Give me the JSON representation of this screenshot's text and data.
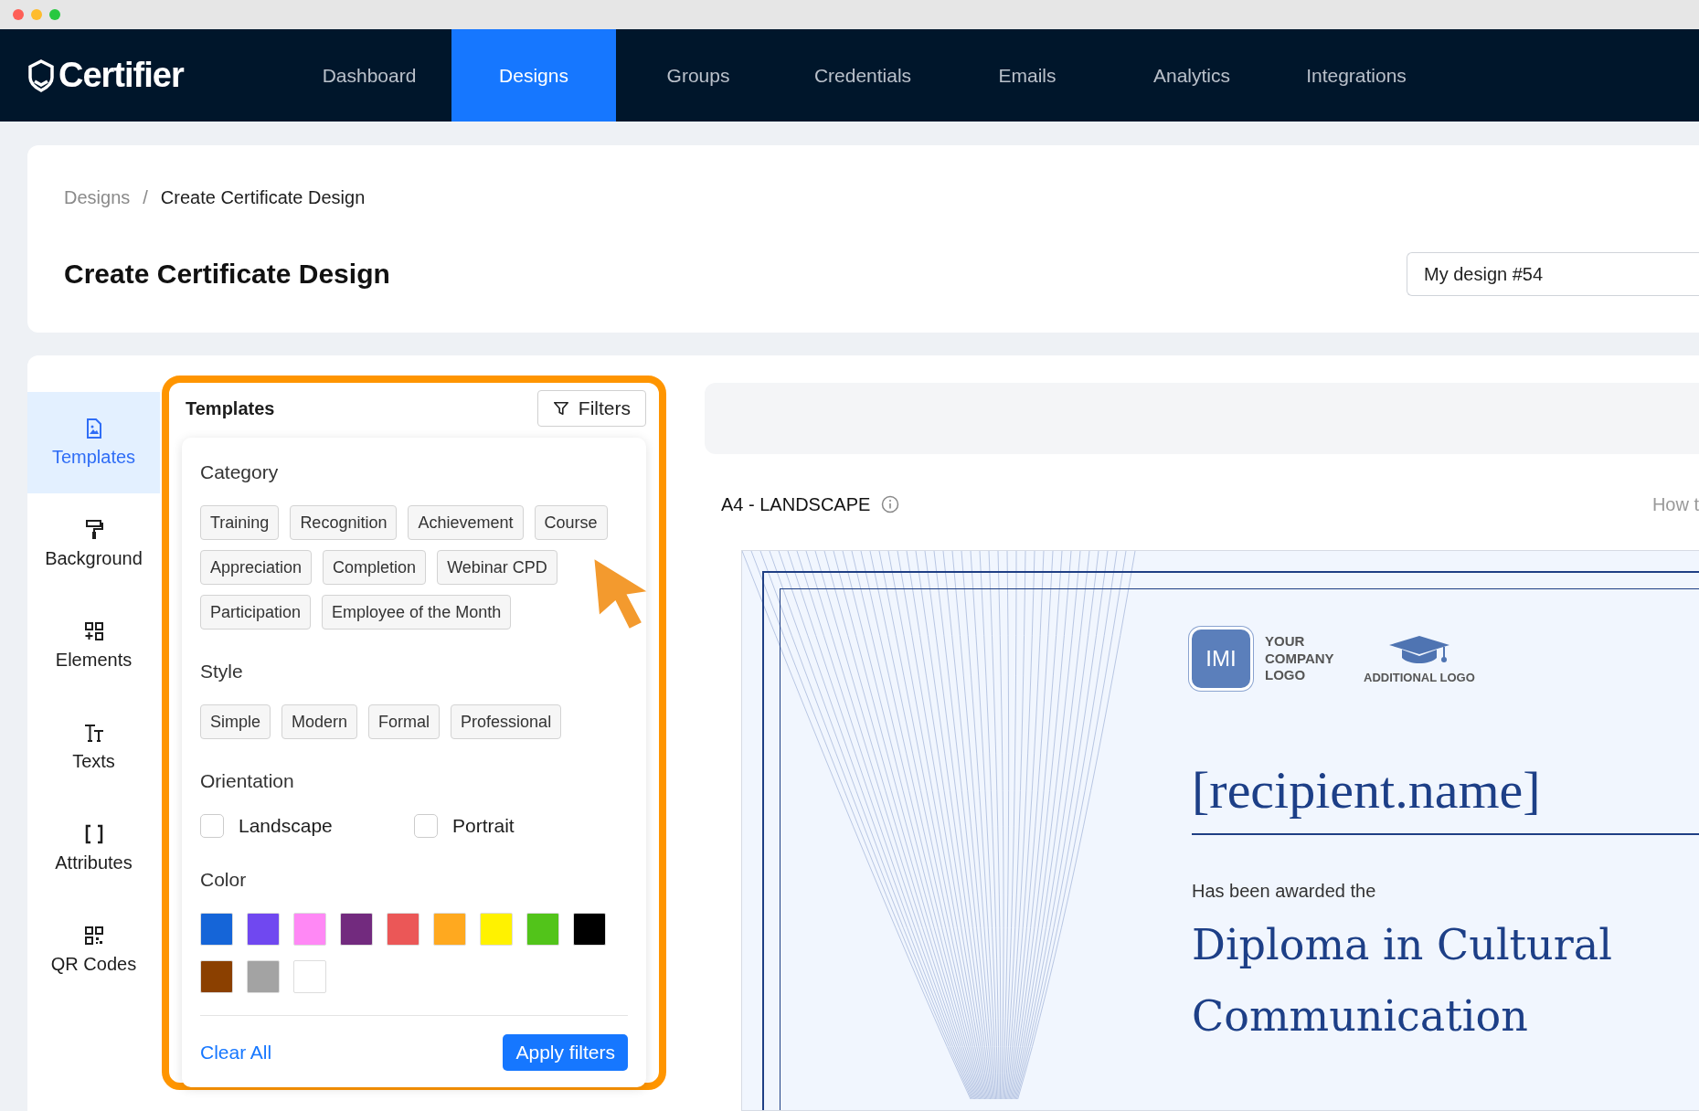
{
  "brand": {
    "name": "Certifier"
  },
  "nav": [
    {
      "label": "Dashboard",
      "selected": false
    },
    {
      "label": "Designs",
      "selected": true
    },
    {
      "label": "Groups",
      "selected": false
    },
    {
      "label": "Credentials",
      "selected": false
    },
    {
      "label": "Emails",
      "selected": false
    },
    {
      "label": "Analytics",
      "selected": false
    },
    {
      "label": "Integrations",
      "selected": false
    }
  ],
  "breadcrumb": [
    "Designs",
    "/",
    "Create Certificate Design"
  ],
  "page_title": "Create Certificate Design",
  "design_name": {
    "value": "My design #54"
  },
  "sidebar": {
    "items": [
      {
        "label": "Templates",
        "kind": "file",
        "selected": true
      },
      {
        "label": "Background",
        "kind": "roller",
        "selected": false
      },
      {
        "label": "Elements",
        "kind": "grid",
        "selected": false
      },
      {
        "label": "Texts",
        "kind": "text",
        "selected": false
      },
      {
        "label": "Attributes",
        "kind": "brackets",
        "selected": false
      },
      {
        "label": "QR Codes",
        "kind": "qr",
        "selected": false
      }
    ]
  },
  "templates_panel": {
    "title": "Templates",
    "filters_button": "Filters",
    "category": {
      "heading": "Category",
      "chips": [
        "Training",
        "Recognition",
        "Achievement",
        "Course",
        "Appreciation",
        "Completion",
        "Webinar CPD",
        "Participation",
        "Employee of the Month"
      ]
    },
    "style": {
      "heading": "Style",
      "chips": [
        "Simple",
        "Modern",
        "Formal",
        "Professional"
      ]
    },
    "orientation": {
      "heading": "Orientation",
      "options": [
        {
          "label": "Landscape",
          "checked": false
        },
        {
          "label": "Portrait",
          "checked": false
        }
      ]
    },
    "color": {
      "heading": "Color",
      "swatches": [
        {
          "color": "#1565d8"
        },
        {
          "color": "#7048f0"
        },
        {
          "color": "#ff88f5"
        },
        {
          "color": "#722a7e"
        },
        {
          "color": "#eb5757"
        },
        {
          "color": "#ffa91f"
        },
        {
          "color": "#fff200"
        },
        {
          "color": "#52c41a"
        },
        {
          "color": "#000000"
        },
        {
          "color": "#8b4000"
        },
        {
          "color": "#a3a3a3"
        },
        {
          "color": "#ffffff"
        }
      ]
    },
    "clear_all": "Clear All",
    "apply": "Apply filters"
  },
  "canvas": {
    "size_label": "A4 - LANDSCAPE",
    "help_link": "How t",
    "certificate": {
      "logo_initials": "IMI",
      "company_logo": "YOUR COMPANY LOGO",
      "additional_logo": "ADDITIONAL LOGO",
      "recipient": "[recipient.name]",
      "awarded": "Has been awarded the",
      "title": "Diploma in Cultural Communication"
    }
  }
}
